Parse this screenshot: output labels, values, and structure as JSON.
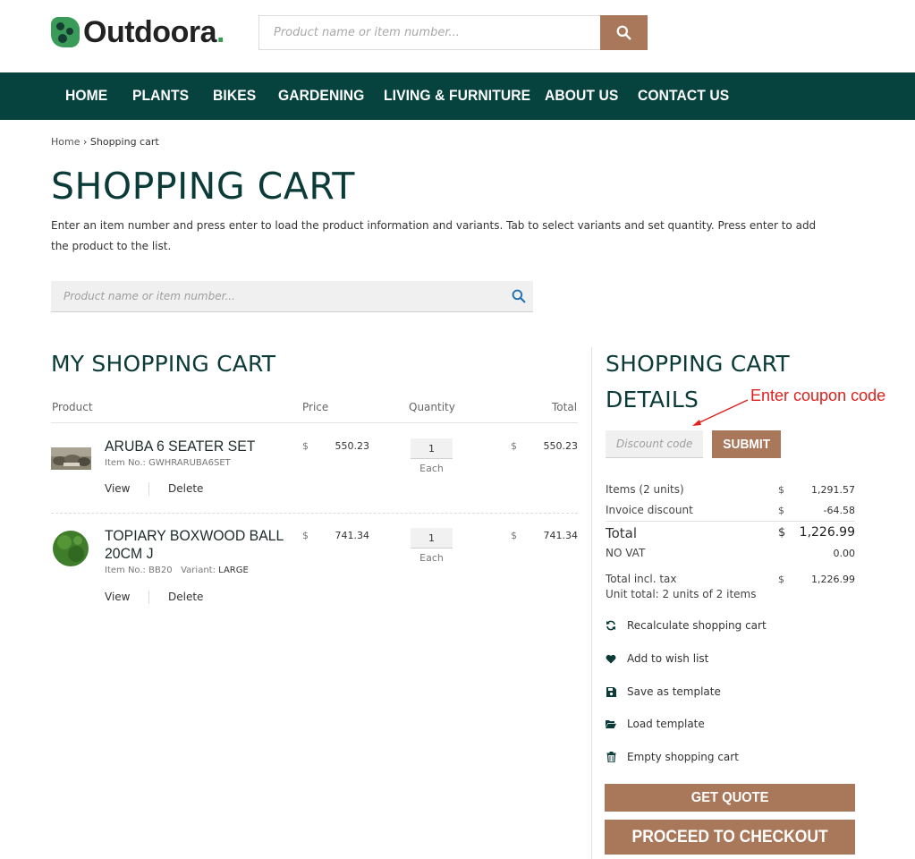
{
  "brand": {
    "name": "Outdoora",
    "dot": "."
  },
  "header": {
    "search_placeholder": "Product name or item number..."
  },
  "nav": [
    "HOME",
    "PLANTS",
    "BIKES",
    "GARDENING",
    "LIVING & FURNITURE",
    "ABOUT US",
    "CONTACT US"
  ],
  "breadcrumb": {
    "home": "Home",
    "separator": "›",
    "current": "Shopping cart"
  },
  "page": {
    "title": "SHOPPING CART",
    "intro": "Enter an item number and press enter to load the product information and variants. Tab to select variants and set quantity. Press enter to add the product to the list.",
    "search_placeholder": "Product name or item number..."
  },
  "cart": {
    "title": "MY SHOPPING CART",
    "columns": {
      "product": "Product",
      "price": "Price",
      "quantity": "Quantity",
      "total": "Total"
    },
    "currency": "$",
    "items": [
      {
        "name": "ARUBA 6 SEATER SET",
        "item_no_label": "Item No.:",
        "item_no": "GWHRARUBA6SET",
        "price": "550.23",
        "quantity": "1",
        "unit": "Each",
        "total": "550.23",
        "view": "View",
        "delete": "Delete"
      },
      {
        "name_line1": "TOPIARY BOXWOOD BALL",
        "name_line2": "20CM J",
        "item_no_label": "Item No.:",
        "item_no": "BB20",
        "variant_label": "Variant:",
        "variant": "LARGE",
        "price": "741.34",
        "quantity": "1",
        "unit": "Each",
        "total": "741.34",
        "view": "View",
        "delete": "Delete"
      }
    ]
  },
  "details": {
    "title_line1": "SHOPPING CART",
    "title_line2": "DETAILS",
    "discount_placeholder": "Discount code",
    "submit": "SUBMIT",
    "summary": {
      "items_label": "Items (2 units)",
      "items_value": "1,291.57",
      "invoice_discount_label": "Invoice discount",
      "invoice_discount_value": "-64.58",
      "total_label": "Total",
      "total_value": "1,226.99",
      "vat_label": "NO VAT",
      "vat_value": "0.00",
      "total_incl_label": "Total incl. tax",
      "total_incl_value": "1,226.99",
      "unit_total": "Unit total: 2 units of 2 items"
    },
    "actions": [
      {
        "label": "Recalculate shopping cart",
        "icon": "refresh-icon"
      },
      {
        "label": "Add to wish list",
        "icon": "heart-icon"
      },
      {
        "label": "Save as template",
        "icon": "save-icon"
      },
      {
        "label": "Load template",
        "icon": "folder-open-icon"
      },
      {
        "label": "Empty shopping cart",
        "icon": "trash-icon"
      }
    ],
    "get_quote": "GET QUOTE",
    "checkout": "PROCEED TO CHECKOUT"
  },
  "annotation": {
    "text": "Enter coupon code",
    "color": "#e0201c"
  },
  "colors": {
    "nav_bg": "#06433e",
    "accent_brown": "#a9785a",
    "title_green": "#0b3b38",
    "brand_green": "#3a9a58"
  }
}
